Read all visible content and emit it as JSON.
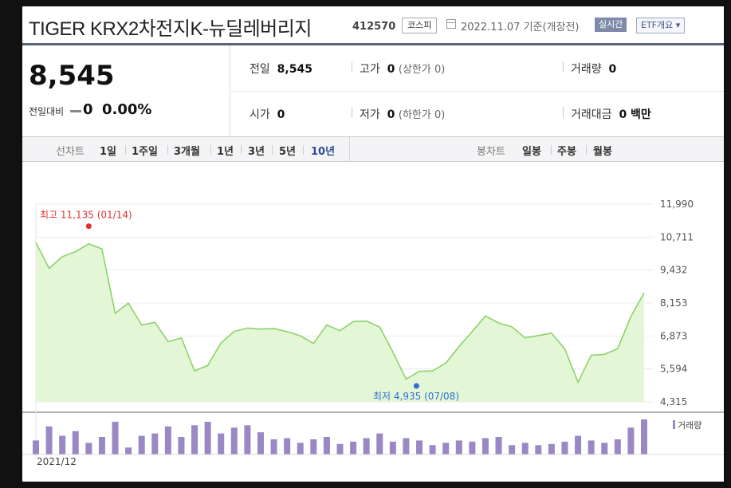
{
  "title": {
    "name": "TIGER KRX2차전지K-뉴딜레버리지",
    "code": "412570",
    "market": "코스피",
    "as_of": "2022.11.07  기준(개장전)",
    "realtime": "실시간",
    "etf_overview": "ETF개요 ▾"
  },
  "quote": {
    "price": "8,545",
    "change_label": "전일대비",
    "change_value": "0",
    "change_rate": "0.00%",
    "prev_close_label": "전일",
    "prev_close": "8,545",
    "high_label": "고가",
    "high": "0",
    "upper_limit": "(상한가 0)",
    "volume_label": "거래량",
    "volume": "0",
    "open_label": "시가",
    "open": "0",
    "low_label": "저가",
    "low": "0",
    "lower_limit": "(하한가 0)",
    "amount_label": "거래대금",
    "amount": "0 백만"
  },
  "tabs": {
    "line_label": "선차트",
    "line": [
      "1일",
      "1주일",
      "3개월",
      "1년",
      "3년",
      "5년",
      "10년"
    ],
    "line_active": 6,
    "candle_label": "봉차트",
    "candle": [
      "일봉",
      "주봉",
      "월봉"
    ]
  },
  "chart_data": {
    "type": "area",
    "x_start_label": "2021/12",
    "ylim": [
      4315,
      11990
    ],
    "yticks": [
      "11,990",
      "10,711",
      "9,432",
      "8,153",
      "6,873",
      "5,594",
      "4,315"
    ],
    "ytick_values": [
      11990,
      10711,
      9432,
      8153,
      6873,
      5594,
      4315
    ],
    "values": [
      10500,
      9500,
      9950,
      10150,
      10450,
      10250,
      7750,
      8150,
      7300,
      7400,
      6650,
      6800,
      5520,
      5730,
      6600,
      7050,
      7180,
      7140,
      7160,
      7040,
      6880,
      6580,
      7300,
      7080,
      7430,
      7450,
      7220,
      6250,
      5200,
      5500,
      5520,
      5820,
      6460,
      7050,
      7650,
      7380,
      7230,
      6800,
      6890,
      6980,
      6370,
      5080,
      6130,
      6160,
      6380,
      7630,
      8545
    ],
    "volumes": [
      12,
      24,
      16,
      20,
      10,
      15,
      28,
      6,
      16,
      18,
      24,
      15,
      25,
      28,
      18,
      23,
      25,
      19,
      13,
      14,
      10,
      13,
      15,
      9,
      11,
      14,
      18,
      11,
      14,
      12,
      8,
      10,
      12,
      11,
      14,
      15,
      8,
      10,
      8,
      9,
      11,
      16,
      12,
      10,
      13,
      23,
      30
    ],
    "volume_max": 30,
    "volume_label": "거래량",
    "max_label": "최고 11,135 (01/14)",
    "max_index": 4,
    "max_value": 11135,
    "min_label": "최저 4,935 (07/08)",
    "min_index": 28,
    "min_value": 4935,
    "colors": {
      "line": "#8cd36a",
      "fill": "#e3f6d6",
      "volume": "#9a88c4",
      "max": "#e03030",
      "min": "#2f6fd6"
    }
  }
}
